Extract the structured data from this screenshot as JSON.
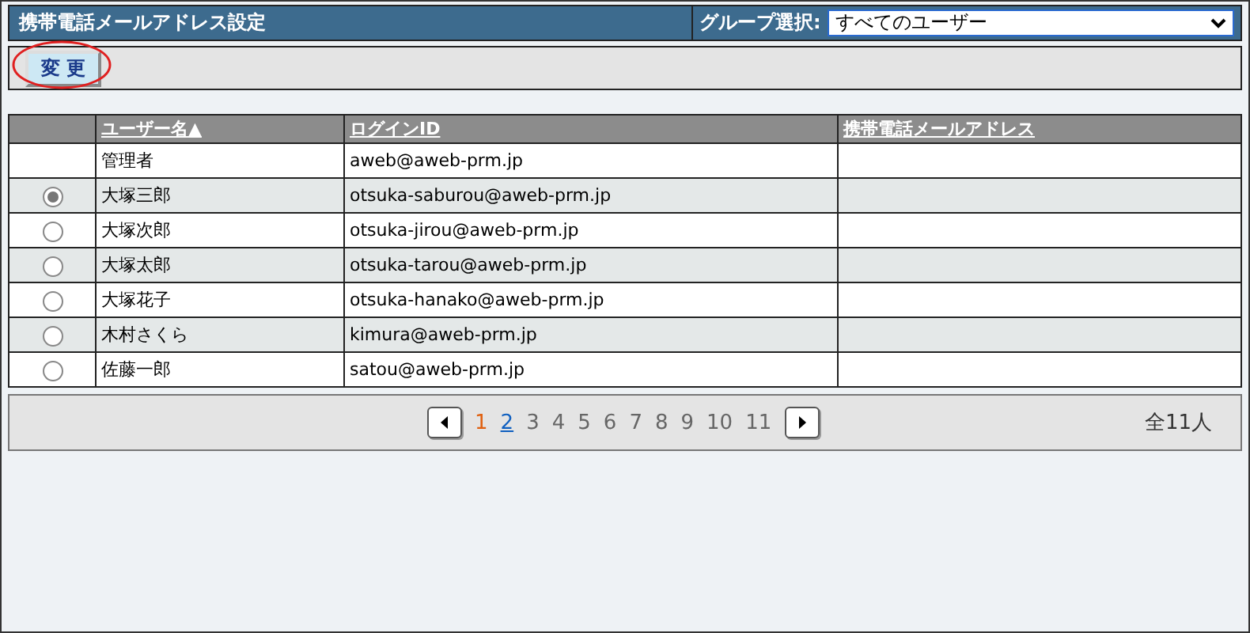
{
  "header": {
    "title": "携帯電話メールアドレス設定",
    "group_label": "グループ選択:",
    "group_value": "すべてのユーザー"
  },
  "toolbar": {
    "button": "変 更",
    "circled": true
  },
  "table": {
    "columns": [
      "ユーザー名▲",
      "ログインID",
      "携帯電話メールアドレス"
    ],
    "rows": [
      {
        "kind": "plain",
        "name": "管理者",
        "login": "aweb@aweb-prm.jp"
      },
      {
        "kind": "radio",
        "selected": true,
        "name": "大塚三郎",
        "login": "otsuka-saburou@aweb-prm.jp"
      },
      {
        "kind": "radio",
        "selected": false,
        "name": "大塚次郎",
        "login": "otsuka-jirou@aweb-prm.jp"
      },
      {
        "kind": "radio",
        "selected": false,
        "name": "大塚太郎",
        "login": "otsuka-tarou@aweb-prm.jp"
      },
      {
        "kind": "radio",
        "selected": false,
        "name": "大塚花子",
        "login": "otsuka-hanako@aweb-prm.jp"
      },
      {
        "kind": "radio",
        "selected": false,
        "name": "木村さくら",
        "login": "kimura@aweb-prm.jp"
      },
      {
        "kind": "radio",
        "selected": false,
        "name": "佐藤一郎",
        "login": "satou@aweb-prm.jp"
      }
    ]
  },
  "pager": {
    "pages": [
      {
        "label": "1",
        "kind": "current"
      },
      {
        "label": "2",
        "kind": "link"
      },
      {
        "label": "3",
        "kind": "plain"
      },
      {
        "label": "4",
        "kind": "plain"
      },
      {
        "label": "5",
        "kind": "plain"
      },
      {
        "label": "6",
        "kind": "plain"
      },
      {
        "label": "7",
        "kind": "plain"
      },
      {
        "label": "8",
        "kind": "plain"
      },
      {
        "label": "9",
        "kind": "plain"
      },
      {
        "label": "10",
        "kind": "plain"
      },
      {
        "label": "11",
        "kind": "plain"
      }
    ],
    "total": "全11人"
  }
}
